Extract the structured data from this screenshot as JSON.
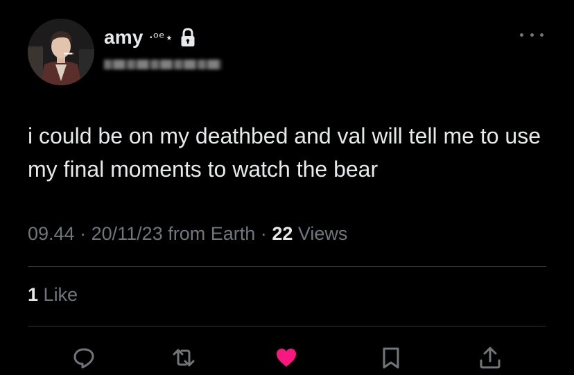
{
  "user": {
    "display_name": "amy",
    "name_decoration": "·ᵒᵉ⋆",
    "avatar_icon": "profile-photo",
    "lock_icon": "lock-icon",
    "handle_redacted": true
  },
  "tweet": {
    "text": "i could be on my deathbed and val will tell me to use my final moments to watch the bear",
    "time": "09.44",
    "date": "20/11/23",
    "source": "from Earth",
    "separator": "·",
    "views_count": "22",
    "views_label": "Views"
  },
  "engagement": {
    "likes_count": "1",
    "likes_label": "Like"
  },
  "actions": {
    "reply_icon": "reply-icon",
    "retweet_icon": "retweet-icon",
    "like_icon": "heart-icon",
    "bookmark_icon": "bookmark-icon",
    "share_icon": "share-icon",
    "like_color": "#f91880",
    "icon_color": "#71767b"
  },
  "colors": {
    "background": "#000000",
    "text": "#e7e9ea",
    "secondary_text": "#71767b",
    "divider": "#2f3336",
    "like_active": "#f91880"
  }
}
